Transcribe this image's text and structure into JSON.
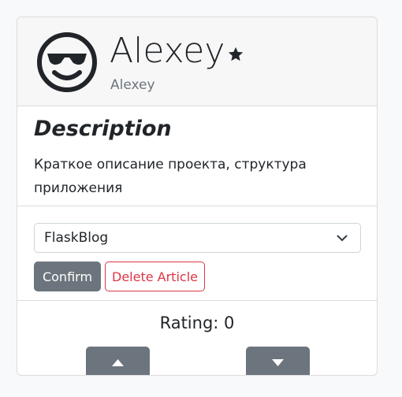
{
  "profile": {
    "name": "Alexey",
    "username": "Alexey",
    "avatar_icon": "smiling-face-with-sunglasses-icon",
    "star_icon": "star-icon"
  },
  "description": {
    "title": "Description",
    "text": "Краткое описание проекта, структура приложения"
  },
  "form": {
    "selected_article": "FlaskBlog",
    "confirm_label": "Confirm",
    "delete_label": "Delete Article"
  },
  "rating": {
    "label": "Rating: 0",
    "up_icon": "triangle-up-icon",
    "down_icon": "triangle-down-icon"
  },
  "colors": {
    "secondary": "#6c757d",
    "danger": "#dc3545",
    "header_bg": "#f7f7f7"
  }
}
